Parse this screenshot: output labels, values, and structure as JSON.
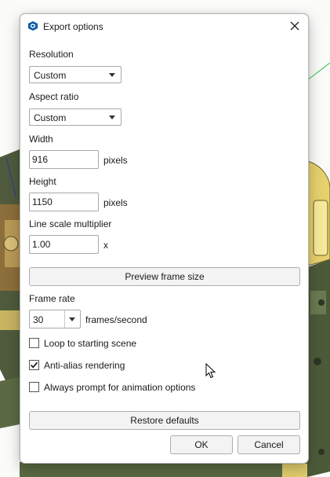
{
  "dialog": {
    "title": "Export options",
    "app_icon": "sketchup-icon",
    "close_icon": "close-icon"
  },
  "resolution": {
    "label": "Resolution",
    "value": "Custom"
  },
  "aspect_ratio": {
    "label": "Aspect ratio",
    "value": "Custom"
  },
  "width": {
    "label": "Width",
    "value": "916",
    "unit": "pixels"
  },
  "height": {
    "label": "Height",
    "value": "1150",
    "unit": "pixels"
  },
  "line_scale": {
    "label": "Line scale multiplier",
    "value": "1.00",
    "unit": "x"
  },
  "preview_button": "Preview frame size",
  "frame_rate": {
    "label": "Frame rate",
    "value": "30",
    "unit": "frames/second"
  },
  "checkboxes": {
    "loop": {
      "label": "Loop to starting scene",
      "checked": false
    },
    "antialias": {
      "label": "Anti-alias rendering",
      "checked": true
    },
    "prompt": {
      "label": "Always prompt for animation options",
      "checked": false
    }
  },
  "restore_button": "Restore defaults",
  "ok_button": "OK",
  "cancel_button": "Cancel",
  "colors": {
    "accent_yellow": "#e9d977",
    "model_green": "#4d5a3a",
    "guide_green": "#2fbf3a"
  }
}
